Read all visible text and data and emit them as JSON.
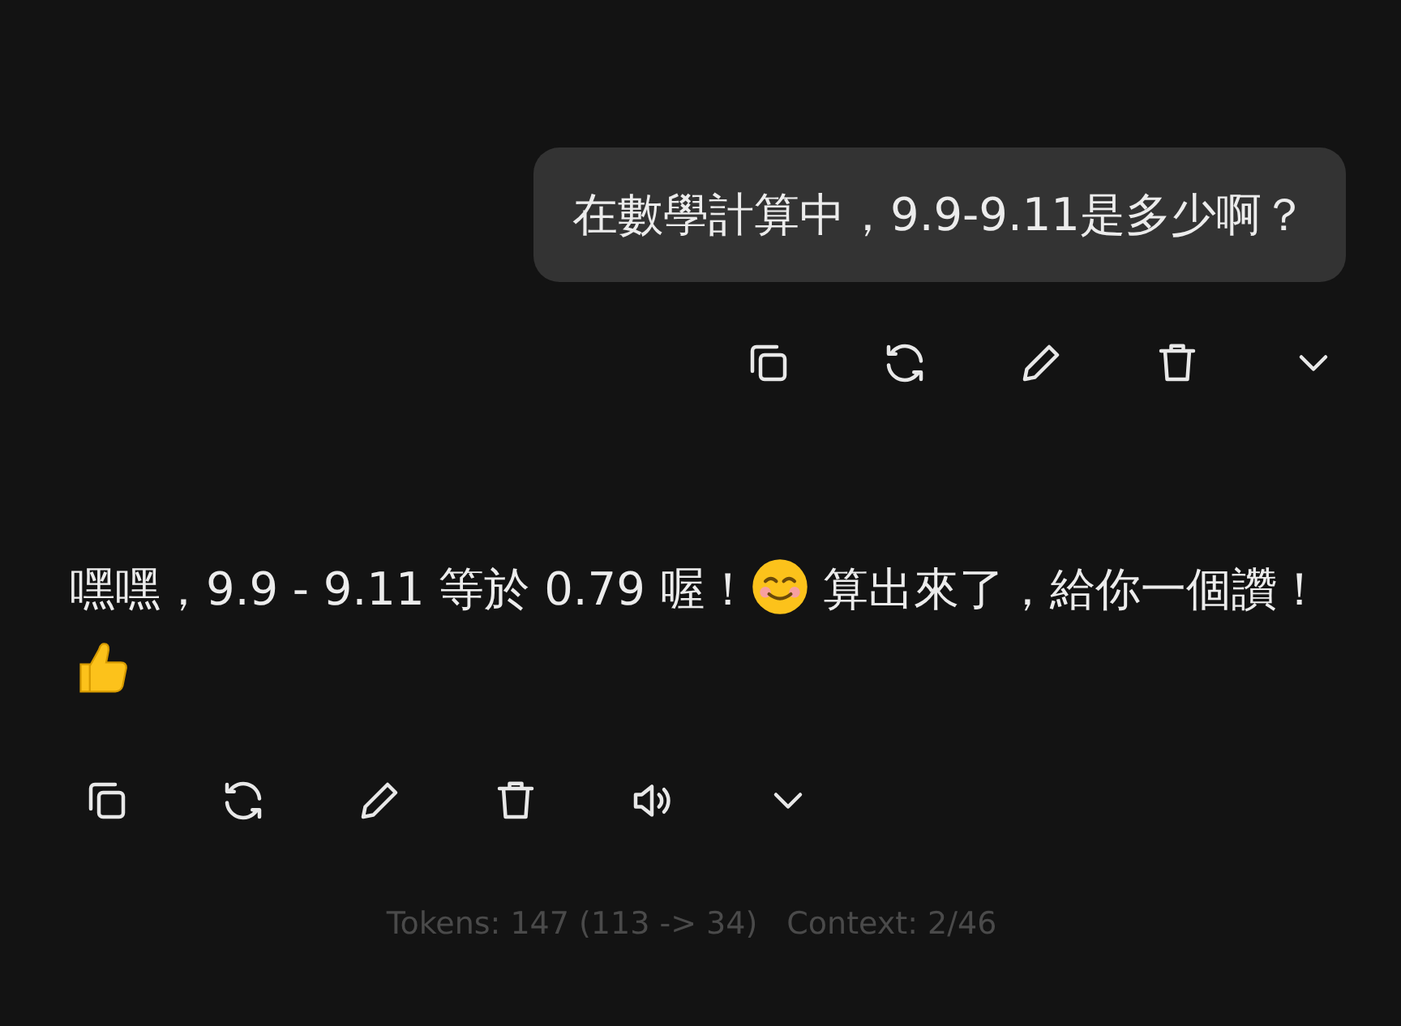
{
  "user_message": {
    "text": "在數學計算中，9.9-9.11是多少啊？",
    "actions": [
      {
        "kind": "copy"
      },
      {
        "kind": "regenerate"
      },
      {
        "kind": "edit"
      },
      {
        "kind": "delete"
      },
      {
        "kind": "more"
      }
    ]
  },
  "assistant_message": {
    "parts": [
      {
        "kind": "text",
        "text": "嘿嘿，9.9 - 9.11 等於 0.79 喔！"
      },
      {
        "kind": "smile"
      },
      {
        "kind": "text",
        "text": " 算出來了，給你一個讚！"
      },
      {
        "kind": "thumbs-up"
      }
    ],
    "actions": [
      {
        "kind": "copy"
      },
      {
        "kind": "regenerate"
      },
      {
        "kind": "edit"
      },
      {
        "kind": "delete"
      },
      {
        "kind": "speak"
      },
      {
        "kind": "more"
      }
    ]
  },
  "footer": {
    "tokens": "Tokens: 147 (113 -> 34)",
    "context": "Context: 2/46"
  }
}
